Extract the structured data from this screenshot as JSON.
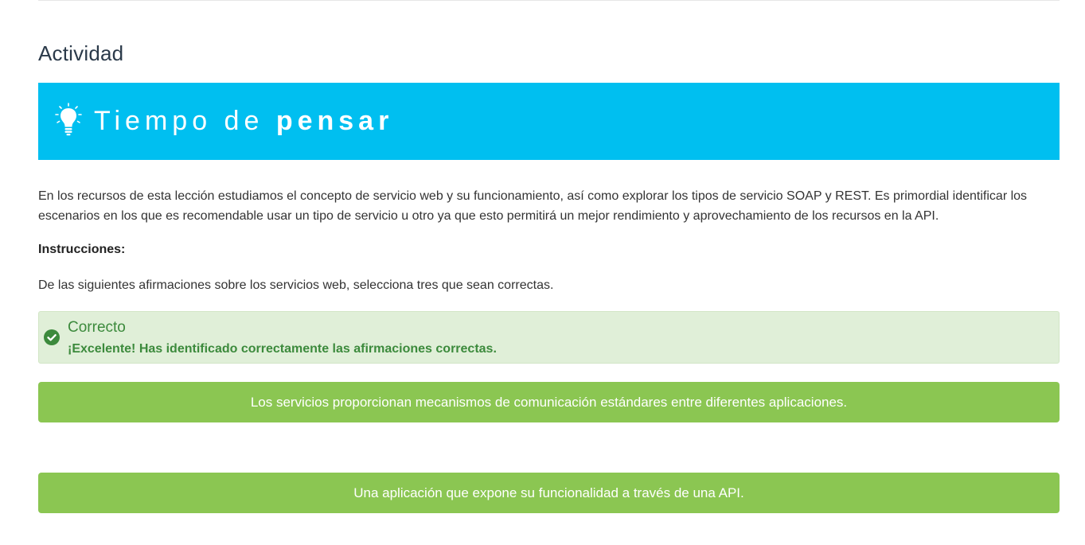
{
  "activity": {
    "title": "Actividad",
    "banner": {
      "text_light": "Tiempo de ",
      "text_bold": "pensar",
      "color": "#00bff0",
      "icon": "lightbulb-icon"
    },
    "intro": "En los recursos de esta lección estudiamos el concepto de servicio web y su funcionamiento, así como explorar los tipos de servicio SOAP y REST. Es primordial identificar los escenarios en los que es recomendable usar un tipo de servicio u otro ya que esto permitirá un mejor rendimiento y aprovechamiento de los recursos en la API.",
    "instructions_label": "Instrucciones:",
    "instructions_text": "De las siguientes afirmaciones sobre los servicios web, selecciona tres que sean correctas."
  },
  "feedback": {
    "icon": "check-circle-icon",
    "title": "Correcto",
    "message": "¡Excelente! Has identificado correctamente las afirmaciones correctas.",
    "color": "#3c8a3c",
    "background": "#e0efd8"
  },
  "options": [
    {
      "label": "Los servicios proporcionan mecanismos de comunicación estándares entre diferentes aplicaciones.",
      "color": "#8bc652"
    },
    {
      "label": "Una aplicación que expone su funcionalidad a través de una API.",
      "color": "#8bc652"
    }
  ]
}
